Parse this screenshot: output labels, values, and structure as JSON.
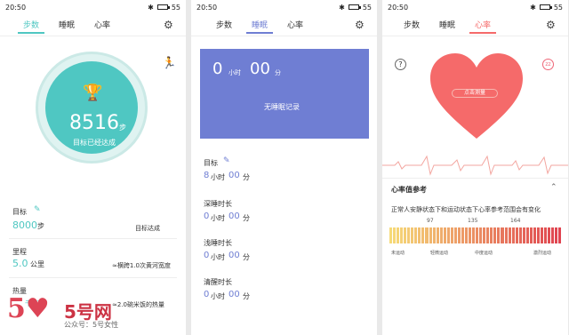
{
  "status": {
    "time": "20:50",
    "battery": "55"
  },
  "tabs": {
    "steps": "步数",
    "sleep": "睡眠",
    "heart": "心率"
  },
  "colors": {
    "steps_accent": "#4fc7c2",
    "sleep_accent": "#6f7ed3",
    "heart_accent": "#f56a6a"
  },
  "steps": {
    "count": "8516",
    "unit": "步",
    "goal_done": "目标已经达成",
    "goal_label": "目标",
    "goal_value": "8000",
    "goal_unit": "步",
    "goal_status": "目标达成",
    "distance_label": "里程",
    "distance_value": "5.0",
    "distance_unit": "公里",
    "distance_compare": "≈横跨1.0次黄河宽度",
    "calorie_label": "热量",
    "calorie_value": "千卡",
    "calorie_compare": "≈2.0碗米饭的热量"
  },
  "sleep": {
    "hours": "0",
    "hours_unit": "小时",
    "minutes": "00",
    "minutes_unit": "分",
    "no_record": "无睡眠记录",
    "goal_label": "目标",
    "goal_hours": "8",
    "goal_hours_unit": "小时",
    "goal_minutes": "00",
    "goal_minutes_unit": "分",
    "deep_label": "深睡时长",
    "deep_hours": "0",
    "deep_minutes": "00",
    "light_label": "浅睡时长",
    "light_hours": "0",
    "light_minutes": "00",
    "awake_label": "清醒时长",
    "awake_hours": "0",
    "awake_minutes": "00",
    "h_unit": "小时",
    "m_unit": "分"
  },
  "heart": {
    "measure_button": "点击测量",
    "ref_title": "心率值参考",
    "ref_desc": "正常人安静状态下和运动状态下心率参考范围会有变化",
    "tick_1": "97",
    "tick_2": "135",
    "tick_3": "164",
    "zone_1": "未运动",
    "zone_2": "轻微运动",
    "zone_3": "中度运动",
    "zone_4": "激烈运动"
  },
  "watermark": {
    "logo": "5♥",
    "name": "5号网",
    "sub": "公众号：5号女性"
  }
}
